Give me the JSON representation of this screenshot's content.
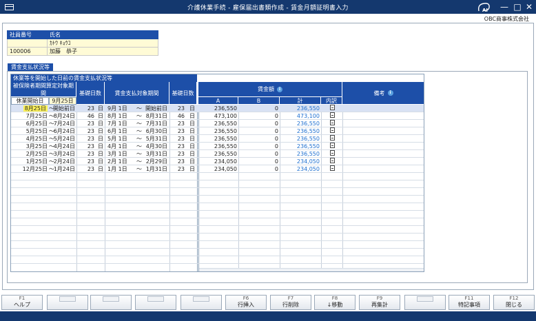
{
  "window": {
    "title": "介護休業手続 - 雇保届出書類作成 - 賃金月額証明書入力",
    "company": "OBC商事株式会社",
    "ai_label": "AI"
  },
  "employee": {
    "col_no": "社員番号",
    "col_name": "氏名",
    "kana": "ｶﾄｳ ｷｮｳｺ",
    "number": "100006",
    "name": "加藤　恭子"
  },
  "section_tab": "賃金支払状況等",
  "grid": {
    "caption": "休業等を開始した日前の賃金支払状況等",
    "h_insured_period": "被保険者期間算定対象期間",
    "h_start_label": "休業開始日",
    "h_start_value": "9月25日",
    "h_base_days": "基礎日数",
    "h_pay_period": "賃金支払対象期間",
    "h_base_days2": "基礎日数",
    "h_wage_amount": "賃金額",
    "h_a": "A",
    "h_b": "B",
    "h_total": "計",
    "h_detail": "内訳",
    "h_remarks": "備考",
    "rows": [
      {
        "from": "8月25日",
        "tilde": "～",
        "to": "開始前日",
        "days": "23",
        "d": "日",
        "pfrom": "9月 1日",
        "ptilde": "～",
        "pto": "開始前日",
        "pdays": "23",
        "pd": "日",
        "a": "236,550",
        "b": "0",
        "total": "236,550"
      },
      {
        "from": "7月25日",
        "tilde": "～",
        "to": "8月24日",
        "days": "46",
        "d": "日",
        "pfrom": "8月 1日",
        "ptilde": "～",
        "pto": "8月31日",
        "pdays": "46",
        "pd": "日",
        "a": "473,100",
        "b": "0",
        "total": "473,100"
      },
      {
        "from": "6月25日",
        "tilde": "～",
        "to": "7月24日",
        "days": "23",
        "d": "日",
        "pfrom": "7月 1日",
        "ptilde": "～",
        "pto": "7月31日",
        "pdays": "23",
        "pd": "日",
        "a": "236,550",
        "b": "0",
        "total": "236,550"
      },
      {
        "from": "5月25日",
        "tilde": "～",
        "to": "6月24日",
        "days": "23",
        "d": "日",
        "pfrom": "6月 1日",
        "ptilde": "～",
        "pto": "6月30日",
        "pdays": "23",
        "pd": "日",
        "a": "236,550",
        "b": "0",
        "total": "236,550"
      },
      {
        "from": "4月25日",
        "tilde": "～",
        "to": "5月24日",
        "days": "23",
        "d": "日",
        "pfrom": "5月 1日",
        "ptilde": "～",
        "pto": "5月31日",
        "pdays": "23",
        "pd": "日",
        "a": "236,550",
        "b": "0",
        "total": "236,550"
      },
      {
        "from": "3月25日",
        "tilde": "～",
        "to": "4月24日",
        "days": "23",
        "d": "日",
        "pfrom": "4月 1日",
        "ptilde": "～",
        "pto": "4月30日",
        "pdays": "23",
        "pd": "日",
        "a": "236,550",
        "b": "0",
        "total": "236,550"
      },
      {
        "from": "2月25日",
        "tilde": "～",
        "to": "3月24日",
        "days": "23",
        "d": "日",
        "pfrom": "3月 1日",
        "ptilde": "～",
        "pto": "3月31日",
        "pdays": "23",
        "pd": "日",
        "a": "236,550",
        "b": "0",
        "total": "236,550"
      },
      {
        "from": "1月25日",
        "tilde": "～",
        "to": "2月24日",
        "days": "23",
        "d": "日",
        "pfrom": "2月 1日",
        "ptilde": "～",
        "pto": "2月29日",
        "pdays": "23",
        "pd": "日",
        "a": "234,050",
        "b": "0",
        "total": "234,050"
      },
      {
        "from": "12月25日",
        "tilde": "～",
        "to": "1月24日",
        "days": "23",
        "d": "日",
        "pfrom": "1月 1日",
        "ptilde": "～",
        "pto": "1月31日",
        "pdays": "23",
        "pd": "日",
        "a": "234,050",
        "b": "0",
        "total": "234,050"
      }
    ]
  },
  "fkeys": [
    {
      "num": "F1",
      "label": "ヘルプ"
    },
    {
      "num": "",
      "label": ""
    },
    {
      "num": "",
      "label": ""
    },
    {
      "num": "",
      "label": ""
    },
    {
      "num": "",
      "label": ""
    },
    {
      "num": "F6",
      "label": "行挿入"
    },
    {
      "num": "F7",
      "label": "行削除"
    },
    {
      "num": "F8",
      "label": "↓移動"
    },
    {
      "num": "F9",
      "label": "再集計"
    },
    {
      "num": "",
      "label": ""
    },
    {
      "num": "F11",
      "label": "特記事項"
    },
    {
      "num": "F12",
      "label": "閉じる"
    }
  ],
  "colors": {
    "header_blue": "#1d4fa8",
    "titlebar": "#14386e",
    "total_blue": "#1d6fd0",
    "start_highlight": "#fff35a"
  }
}
